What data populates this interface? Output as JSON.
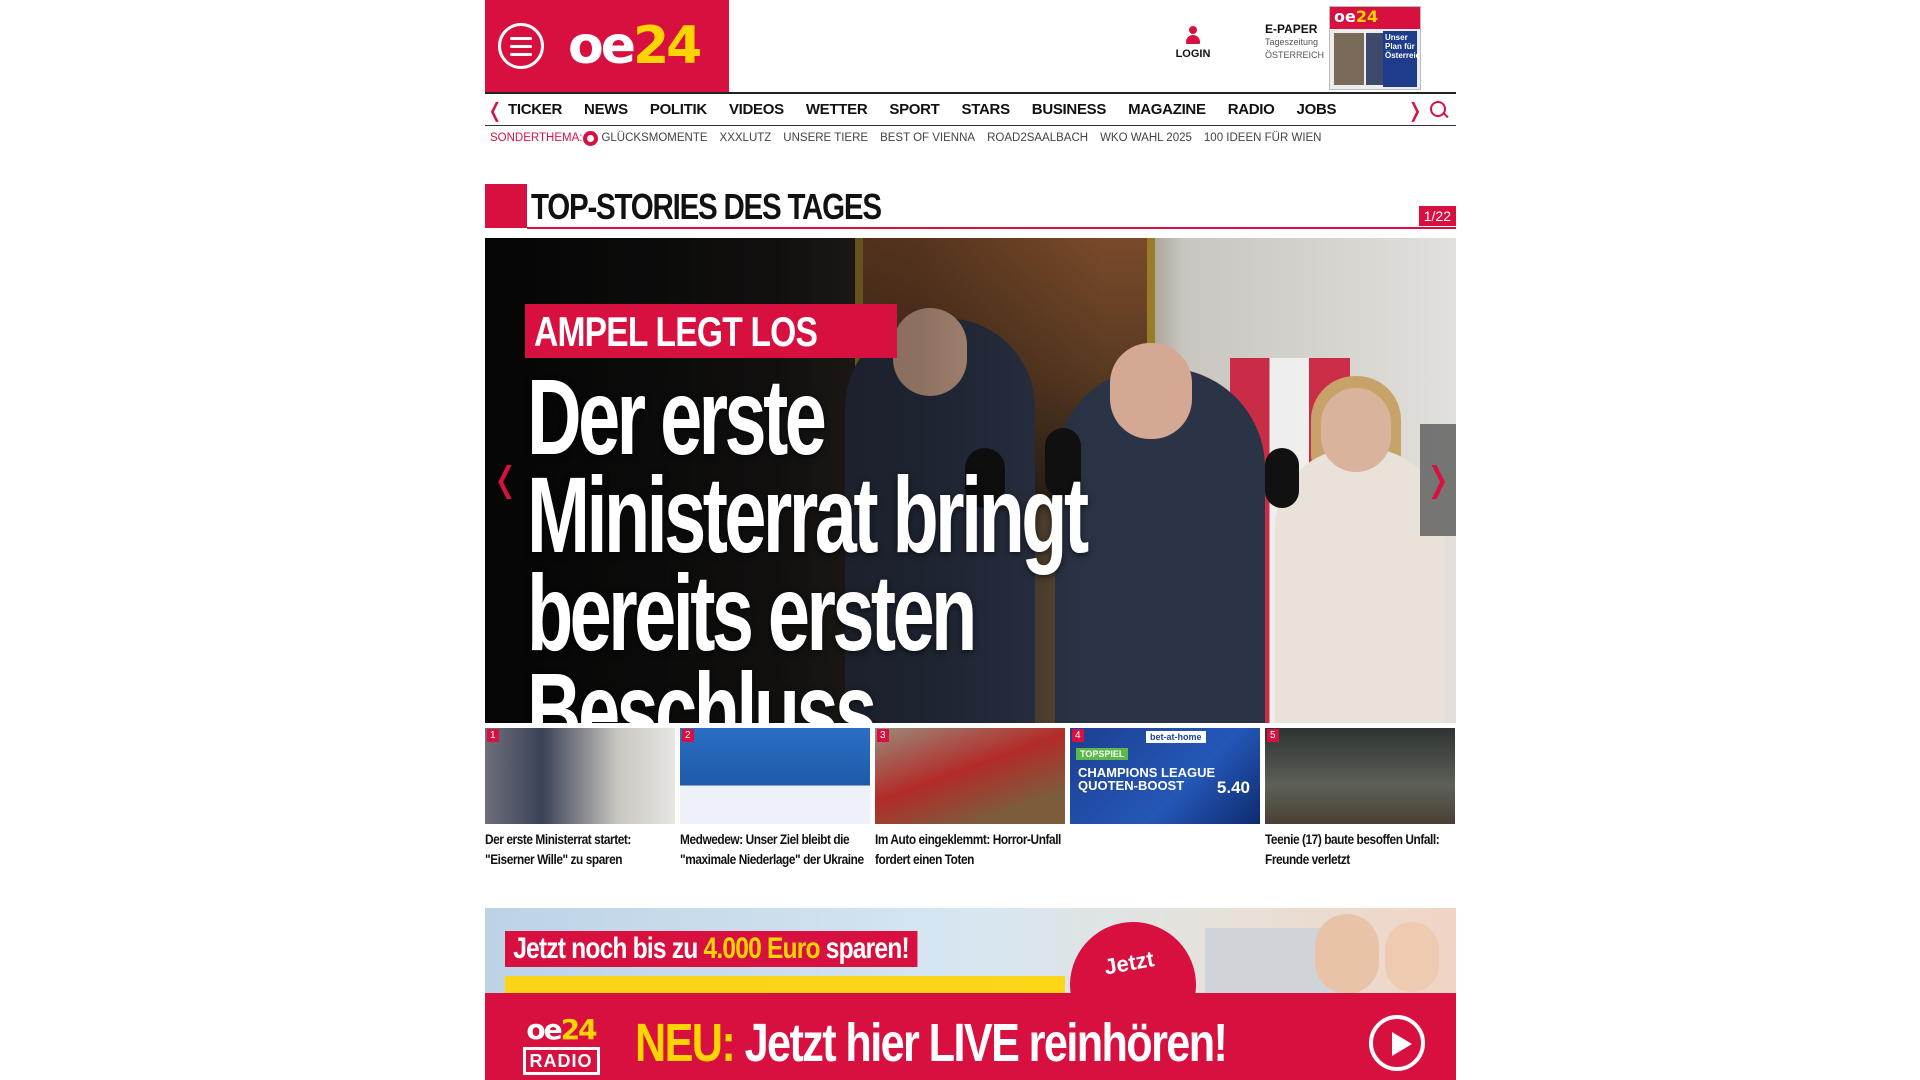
{
  "header": {
    "logo_main": "oe",
    "logo_accent": "24",
    "login_label": "LOGIN",
    "epaper": {
      "title": "E-PAPER",
      "subtitle1": "Tageszeitung",
      "subtitle2": "ÖSTERREICH",
      "cover_logo_main": "oe",
      "cover_logo_accent": "24",
      "cover_headline": "Unser Plan für Österreich"
    }
  },
  "nav": {
    "items": [
      {
        "label": "TICKER"
      },
      {
        "label": "NEWS"
      },
      {
        "label": "POLITIK"
      },
      {
        "label": "VIDEOS"
      },
      {
        "label": "WETTER"
      },
      {
        "label": "SPORT"
      },
      {
        "label": "STARS"
      },
      {
        "label": "BUSINESS"
      },
      {
        "label": "MAGAZINE"
      },
      {
        "label": "RADIO"
      },
      {
        "label": "JOBS"
      }
    ],
    "left_arrow": "❬",
    "right_arrow": "❭"
  },
  "subnav": {
    "label": "SONDERTHEMA:",
    "items": [
      {
        "label": "GLÜCKSMOMENTE"
      },
      {
        "label": "XXXLUTZ"
      },
      {
        "label": "UNSERE TIERE"
      },
      {
        "label": "BEST OF VIENNA"
      },
      {
        "label": "ROAD2SAALBACH"
      },
      {
        "label": "WKO WAHL 2025"
      },
      {
        "label": "100 IDEEN FÜR WIEN"
      }
    ]
  },
  "section": {
    "title": "TOP-STORIES DES TAGES",
    "counter": "1/22"
  },
  "hero": {
    "kicker": "AMPEL LEGT LOS",
    "headline_line1": "Der erste",
    "headline_line2": "Ministerrat bringt",
    "headline_line3": "bereits ersten Beschluss",
    "prev_arrow": "❬",
    "next_arrow": "❭"
  },
  "thumbs": [
    {
      "num": "1",
      "caption": "Der erste Ministerrat startet: \"Eiserner Wille\" zu sparen"
    },
    {
      "num": "2",
      "caption": "Medwedew: Unser Ziel bleibt die \"maximale Niederlage\" der Ukraine"
    },
    {
      "num": "3",
      "caption": "Im Auto eingeklemmt: Horror-Unfall fordert einen Toten"
    },
    {
      "num": "4",
      "caption": "",
      "ad_brand": "bet-at-home",
      "ad_green": "TOPSPIEL",
      "ad_title1": "CHAMPIONS LEAGUE",
      "ad_title2": "QUOTEN-BOOST",
      "ad_quote": "5.40"
    },
    {
      "num": "5",
      "caption": "Teenie (17) baute besoffen Unfall: Freunde verletzt"
    }
  ],
  "banner": {
    "text_prefix": "Jetzt noch bis zu ",
    "text_amount": "4.000 Euro",
    "text_suffix": " sparen!",
    "badge": "Jetzt"
  },
  "radio": {
    "logo_main": "oe",
    "logo_accent": "24",
    "logo_sub": "RADIO",
    "text_prefix": "NEU:",
    "text_main": " Jetzt hier LIVE reinhören!"
  }
}
